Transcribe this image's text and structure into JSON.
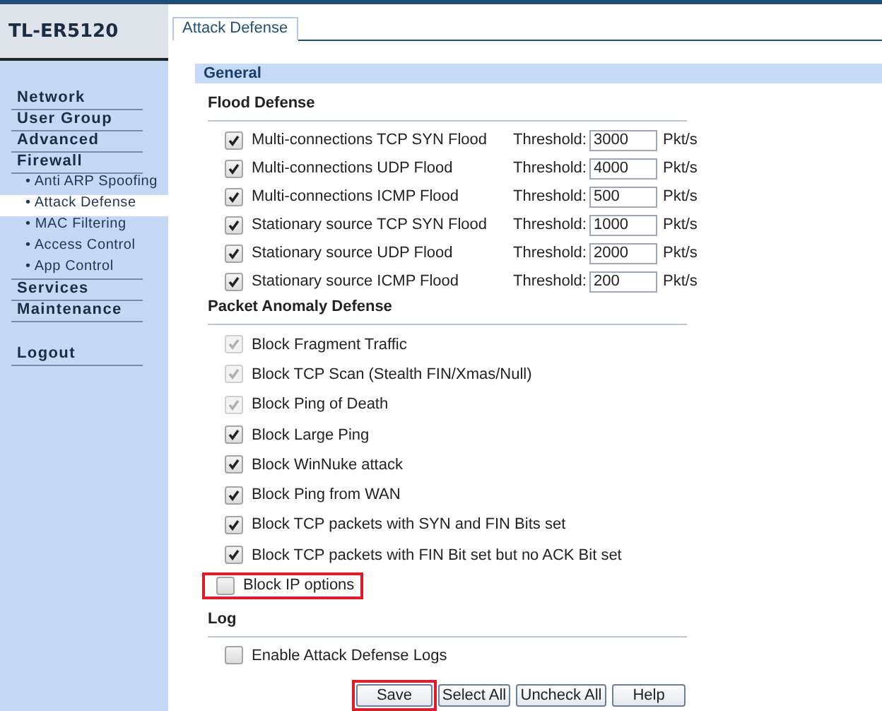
{
  "device": {
    "model": "TL-ER5120"
  },
  "sidebar": {
    "items": [
      {
        "label": "Network",
        "kind": "group",
        "selected": false
      },
      {
        "label": "User Group",
        "kind": "group",
        "selected": false
      },
      {
        "label": "Advanced",
        "kind": "group",
        "selected": false
      },
      {
        "label": "Firewall",
        "kind": "group",
        "selected": false
      },
      {
        "label": "• Anti ARP Spoofing",
        "kind": "sub",
        "selected": false
      },
      {
        "label": "• Attack Defense",
        "kind": "sub",
        "selected": true
      },
      {
        "label": "• MAC Filtering",
        "kind": "sub",
        "selected": false
      },
      {
        "label": "• Access Control",
        "kind": "sub",
        "selected": false
      },
      {
        "label": "• App Control",
        "kind": "sub-last",
        "selected": false
      },
      {
        "label": "Services",
        "kind": "group",
        "selected": false
      },
      {
        "label": "Maintenance",
        "kind": "group",
        "selected": false
      },
      {
        "label": "Logout",
        "kind": "logout",
        "selected": false
      }
    ]
  },
  "tabs": [
    {
      "label": "Attack Defense",
      "selected": true
    }
  ],
  "section": {
    "title": "General"
  },
  "flood_defense": {
    "title": "Flood Defense",
    "rows": [
      {
        "label": "Multi-connections TCP SYN Flood",
        "checked": true,
        "threshold_label": "Threshold:",
        "threshold": "3000",
        "unit": "Pkt/s"
      },
      {
        "label": "Multi-connections UDP Flood",
        "checked": true,
        "threshold_label": "Threshold:",
        "threshold": "4000",
        "unit": "Pkt/s"
      },
      {
        "label": "Multi-connections ICMP Flood",
        "checked": true,
        "threshold_label": "Threshold:",
        "threshold": "500",
        "unit": "Pkt/s"
      },
      {
        "label": "Stationary source TCP SYN Flood",
        "checked": true,
        "threshold_label": "Threshold:",
        "threshold": "1000",
        "unit": "Pkt/s"
      },
      {
        "label": "Stationary source UDP Flood",
        "checked": true,
        "threshold_label": "Threshold:",
        "threshold": "2000",
        "unit": "Pkt/s"
      },
      {
        "label": "Stationary source ICMP Flood",
        "checked": true,
        "threshold_label": "Threshold:",
        "threshold": "200",
        "unit": "Pkt/s"
      }
    ]
  },
  "packet_anomaly_defense": {
    "title": "Packet Anomaly Defense",
    "items": [
      {
        "label": "Block Fragment Traffic",
        "checked": true,
        "disabled": true,
        "highlighted": false
      },
      {
        "label": "Block TCP Scan (Stealth FIN/Xmas/Null)",
        "checked": true,
        "disabled": true,
        "highlighted": false
      },
      {
        "label": "Block Ping of Death",
        "checked": true,
        "disabled": true,
        "highlighted": false
      },
      {
        "label": "Block Large Ping",
        "checked": true,
        "disabled": false,
        "highlighted": false
      },
      {
        "label": "Block WinNuke attack",
        "checked": true,
        "disabled": false,
        "highlighted": false
      },
      {
        "label": "Block Ping from WAN",
        "checked": true,
        "disabled": false,
        "highlighted": false
      },
      {
        "label": "Block TCP packets with SYN and FIN Bits set",
        "checked": true,
        "disabled": false,
        "highlighted": false
      },
      {
        "label": "Block TCP packets with FIN Bit set but no ACK Bit set",
        "checked": true,
        "disabled": false,
        "highlighted": false
      },
      {
        "label": "Block IP options",
        "checked": false,
        "disabled": false,
        "highlighted": true
      }
    ]
  },
  "log": {
    "title": "Log",
    "items": [
      {
        "label": "Enable Attack Defense Logs",
        "checked": false
      }
    ]
  },
  "buttons": [
    {
      "label": "Save",
      "highlighted": true
    },
    {
      "label": "Select All",
      "highlighted": false
    },
    {
      "label": "Uncheck All",
      "highlighted": false
    },
    {
      "label": "Help",
      "highlighted": false
    }
  ]
}
